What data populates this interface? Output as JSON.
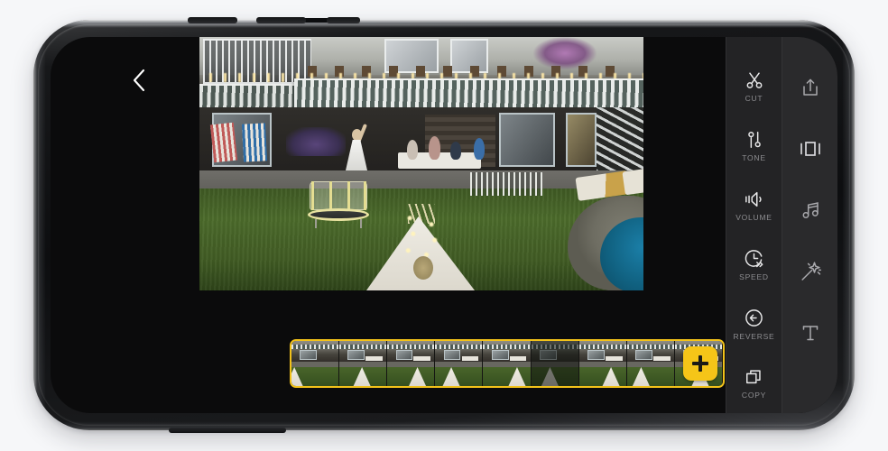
{
  "app": {
    "screen_name": "video-editor",
    "background_color": "#f6f7f9",
    "accent_color": "#f5c518",
    "panel_color": "#232325"
  },
  "header": {
    "back_icon": "chevron-left-icon",
    "back_label": ""
  },
  "preview": {
    "description": "Backyard evening scene: house with striped awning and string lights, people dining at a table, girl in white dress on a trampoline, lit teepee tent on the lawn, swimming pool",
    "is_playing": false
  },
  "tool_rail": {
    "primary_tools": [
      {
        "label": "CUT",
        "icon": "scissors-icon"
      },
      {
        "label": "TONE",
        "icon": "sliders-icon"
      },
      {
        "label": "VOLUME",
        "icon": "speaker-icon"
      },
      {
        "label": "SPEED",
        "icon": "clock-fast-forward-icon"
      },
      {
        "label": "REVERSE",
        "icon": "arrow-left-circle-icon"
      },
      {
        "label": "COPY",
        "icon": "duplicate-icon"
      }
    ],
    "secondary_tools": [
      {
        "label": "",
        "icon": "share-icon"
      },
      {
        "label": "",
        "icon": "aspect-ratio-icon"
      },
      {
        "label": "",
        "icon": "music-note-icon"
      },
      {
        "label": "",
        "icon": "magic-wand-icon"
      },
      {
        "label": "",
        "icon": "text-icon"
      }
    ]
  },
  "timeline": {
    "selected": true,
    "selection_color": "#f2c21a",
    "add_button_label": "+",
    "add_button_icon": "plus-icon",
    "frame_count": 9
  },
  "device": {
    "buttons": [
      "volume-up",
      "volume-down",
      "power"
    ]
  }
}
